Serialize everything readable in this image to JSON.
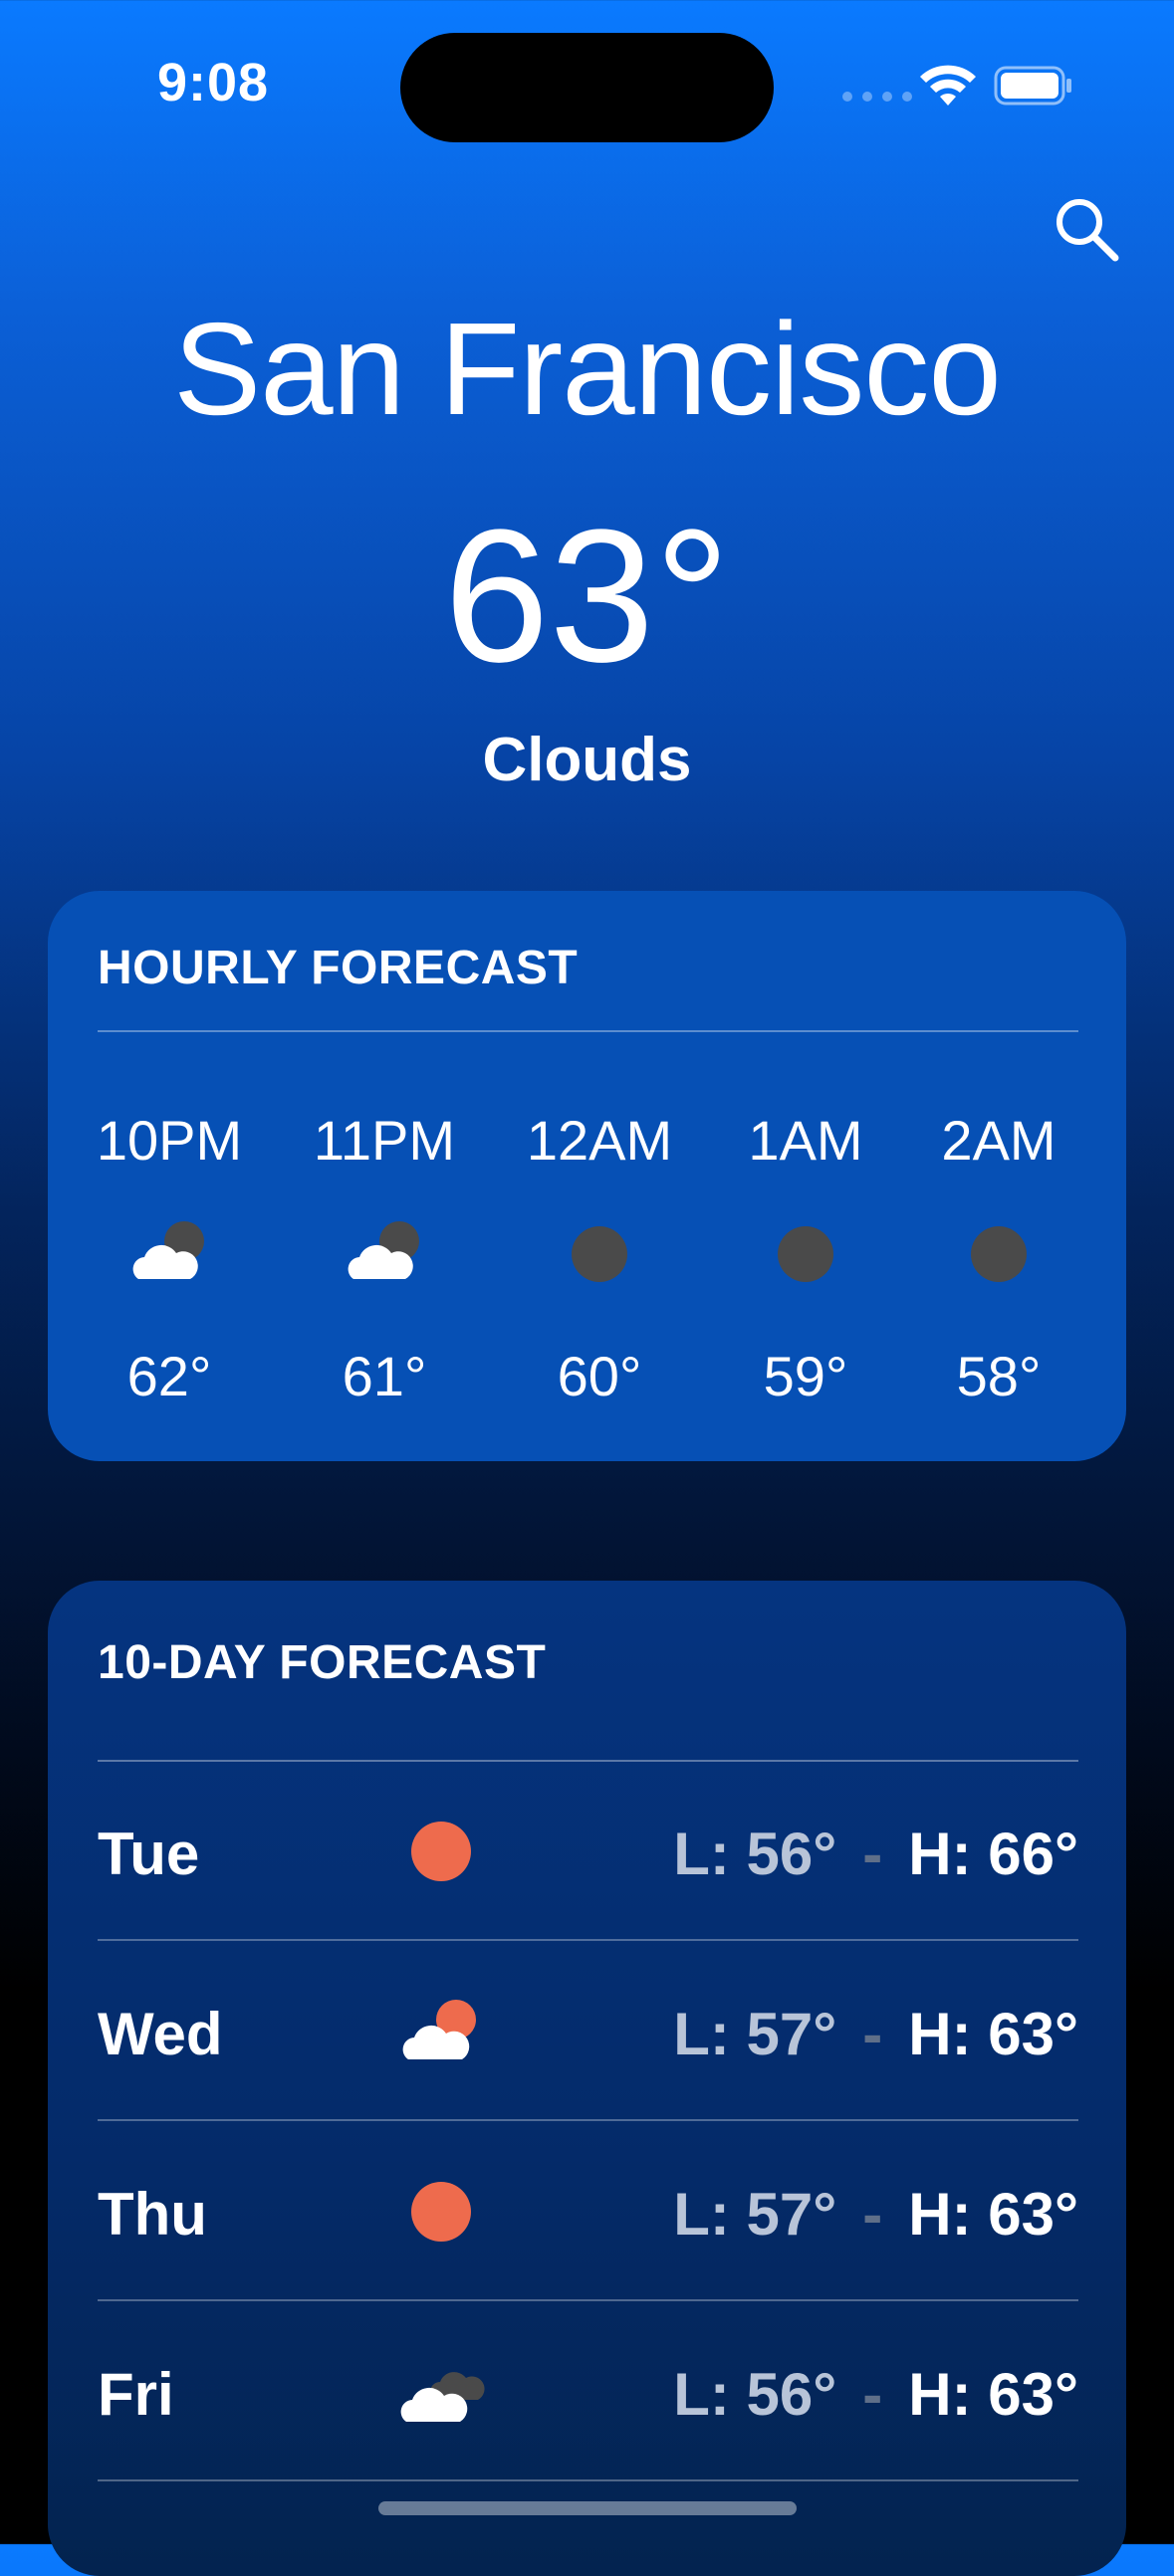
{
  "status_bar": {
    "time": "9:08"
  },
  "header": {
    "search_icon": "search-icon",
    "city": "San Francisco",
    "temperature": "63°",
    "condition": "Clouds"
  },
  "hourly": {
    "title": "HOURLY FORECAST",
    "items": [
      {
        "time": "10PM",
        "icon": "cloud-moon-icon",
        "temp": "62°"
      },
      {
        "time": "11PM",
        "icon": "cloud-moon-icon",
        "temp": "61°"
      },
      {
        "time": "12AM",
        "icon": "moon-icon",
        "temp": "60°"
      },
      {
        "time": "1AM",
        "icon": "moon-icon",
        "temp": "59°"
      },
      {
        "time": "2AM",
        "icon": "moon-icon",
        "temp": "58°"
      }
    ]
  },
  "daily": {
    "title": "10-DAY FORECAST",
    "items": [
      {
        "day": "Tue",
        "icon": "sun-icon",
        "low": "L: 56°",
        "high": "H: 66°"
      },
      {
        "day": "Wed",
        "icon": "cloud-sun-icon",
        "low": "L: 57°",
        "high": "H: 63°"
      },
      {
        "day": "Thu",
        "icon": "sun-icon",
        "low": "L: 57°",
        "high": "H: 63°"
      },
      {
        "day": "Fri",
        "icon": "cloudy-icon",
        "low": "L: 56°",
        "high": "H: 63°"
      }
    ],
    "separator": "-"
  },
  "colors": {
    "sun": "#ee6b4d",
    "moon": "#4a4a4a",
    "cloud": "#ffffff"
  }
}
